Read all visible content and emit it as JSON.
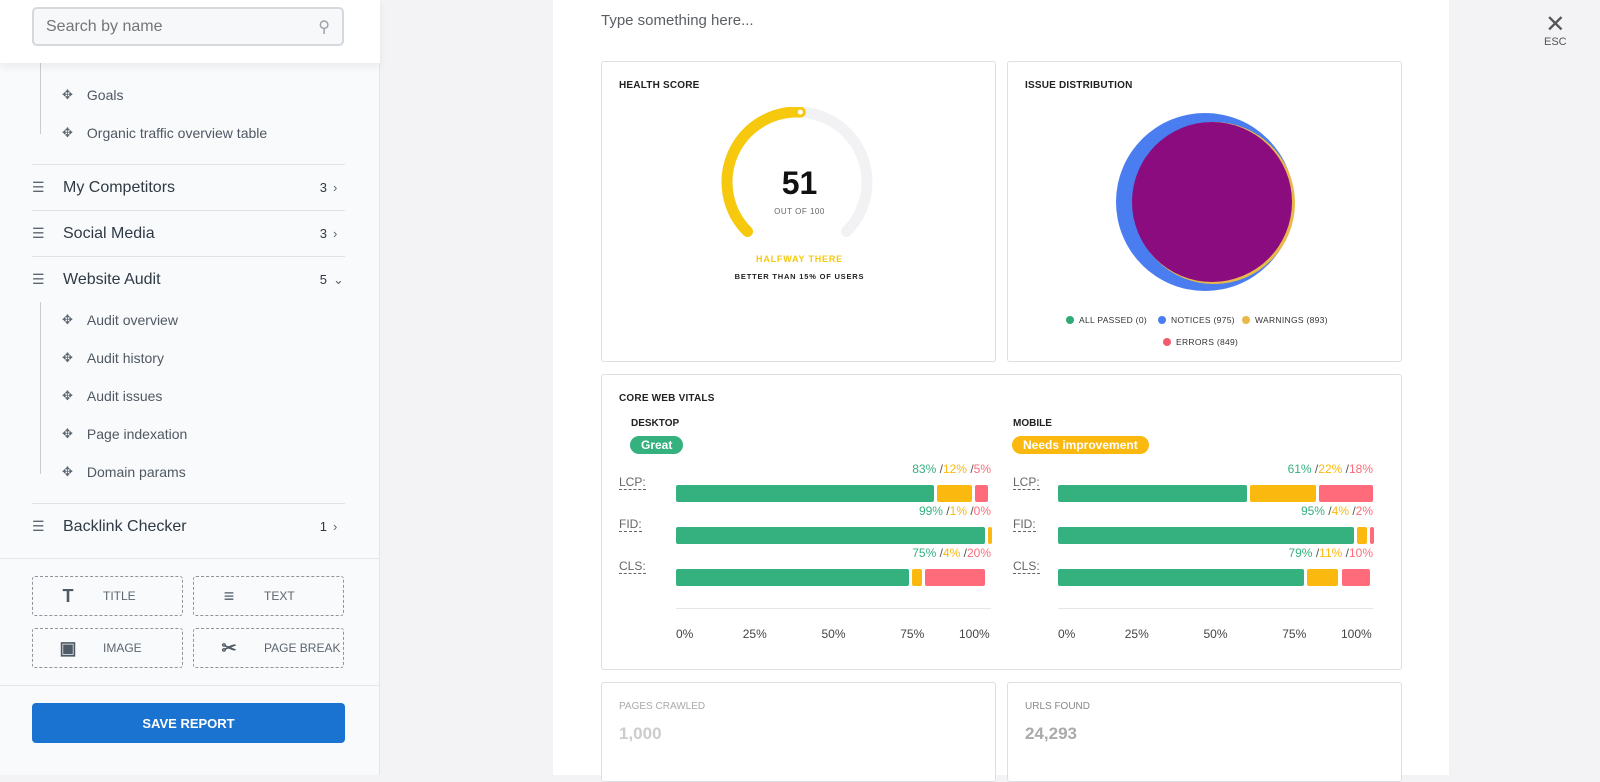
{
  "sidebar": {
    "search_placeholder": "Search by name",
    "items_top": [
      "Goals",
      "Organic traffic overview table"
    ],
    "groups": [
      {
        "label": "My Competitors",
        "count": "3",
        "expanded": false
      },
      {
        "label": "Social Media",
        "count": "3",
        "expanded": false
      },
      {
        "label": "Website Audit",
        "count": "5",
        "expanded": true
      },
      {
        "label": "Backlink Checker",
        "count": "1",
        "expanded": false
      }
    ],
    "audit_items": [
      "Audit overview",
      "Audit history",
      "Audit issues",
      "Page indexation",
      "Domain params"
    ],
    "blocks": {
      "title": "TITLE",
      "text": "TEXT",
      "image": "IMAGE",
      "page_break": "PAGE BREAK"
    },
    "save_label": "SAVE REPORT"
  },
  "close": {
    "label": "ESC"
  },
  "report": {
    "text_placeholder": "Type something here...",
    "health": {
      "title": "HEALTH SCORE",
      "score": "51",
      "out_of": "OUT OF 100",
      "status": "HALFWAY THERE",
      "compare": "BETTER THAN 15% OF USERS",
      "value": 51,
      "color": "#f6c90e"
    },
    "issues": {
      "title": "ISSUE DISTRIBUTION",
      "legend": [
        {
          "label": "ALL PASSED (0)",
          "color": "#2eaa78"
        },
        {
          "label": "NOTICES (975)",
          "color": "#4a7df0"
        },
        {
          "label": "WARNINGS (893)",
          "color": "#e8b84a"
        },
        {
          "label": "ERRORS (849)",
          "color": "#f25a6e"
        }
      ],
      "pie_fill": "#8a0c7e"
    },
    "cwv": {
      "title": "CORE WEB VITALS",
      "ticks": [
        "0%",
        "25%",
        "50%",
        "75%",
        "100%"
      ],
      "colors": {
        "good": "#35b07f",
        "mid": "#fbb80f",
        "bad": "#ff6b7a"
      },
      "desktop": {
        "label": "DESKTOP",
        "badge": "Great",
        "badge_color": "#35b07f",
        "rows": [
          {
            "metric": "LCP:",
            "good": 83,
            "mid": 12,
            "bad": 5,
            "good_l": "83%",
            "mid_l": "12%",
            "bad_l": "5%"
          },
          {
            "metric": "FID:",
            "good": 99,
            "mid": 1,
            "bad": 0,
            "good_l": "99%",
            "mid_l": "1%",
            "bad_l": "0%"
          },
          {
            "metric": "CLS:",
            "good": 75,
            "mid": 4,
            "bad": 20,
            "good_l": "75%",
            "mid_l": "4%",
            "bad_l": "20%"
          }
        ]
      },
      "mobile": {
        "label": "MOBILE",
        "badge": "Needs improvement",
        "badge_color": "#fbb80f",
        "rows": [
          {
            "metric": "LCP:",
            "good": 61,
            "mid": 22,
            "bad": 18,
            "good_l": "61%",
            "mid_l": "22%",
            "bad_l": "18%"
          },
          {
            "metric": "FID:",
            "good": 95,
            "mid": 4,
            "bad": 2,
            "good_l": "95%",
            "mid_l": "4%",
            "bad_l": "2%"
          },
          {
            "metric": "CLS:",
            "good": 79,
            "mid": 11,
            "bad": 10,
            "good_l": "79%",
            "mid_l": "11%",
            "bad_l": "10%"
          }
        ]
      }
    },
    "pages_crawled": {
      "title": "PAGES CRAWLED",
      "value": "1,000"
    },
    "urls_found": {
      "title": "URLS FOUND",
      "value": "24,293"
    }
  }
}
